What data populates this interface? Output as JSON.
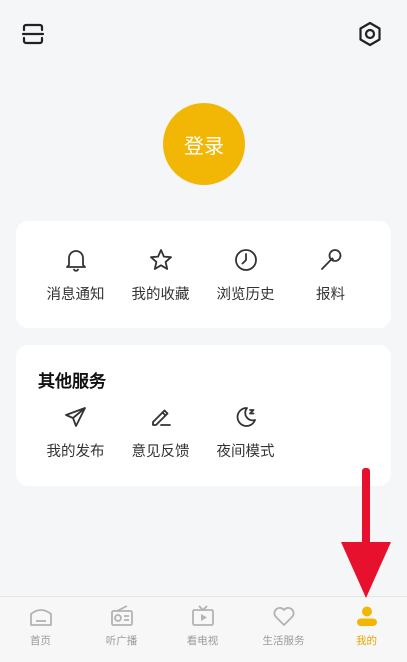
{
  "header": {
    "scan_icon": "scan-icon",
    "settings_icon": "settings-icon"
  },
  "login": {
    "label": "登录"
  },
  "quick_actions": [
    {
      "label": "消息通知",
      "icon": "bell-icon"
    },
    {
      "label": "我的收藏",
      "icon": "star-icon"
    },
    {
      "label": "浏览历史",
      "icon": "clock-icon"
    },
    {
      "label": "报料",
      "icon": "microphone-icon"
    }
  ],
  "other_services": {
    "title": "其他服务",
    "items": [
      {
        "label": "我的发布",
        "icon": "paper-plane-icon"
      },
      {
        "label": "意见反馈",
        "icon": "pencil-icon"
      },
      {
        "label": "夜间模式",
        "icon": "moon-icon"
      }
    ]
  },
  "tabbar": {
    "items": [
      {
        "label": "首页",
        "icon": "home-icon",
        "active": false
      },
      {
        "label": "听广播",
        "icon": "radio-icon",
        "active": false
      },
      {
        "label": "看电视",
        "icon": "tv-icon",
        "active": false
      },
      {
        "label": "生活服务",
        "icon": "heart-icon",
        "active": false
      },
      {
        "label": "我的",
        "icon": "profile-icon",
        "active": true
      }
    ]
  },
  "colors": {
    "accent": "#f2b705",
    "active_tab": "#e8a600",
    "arrow": "#e8112d"
  }
}
